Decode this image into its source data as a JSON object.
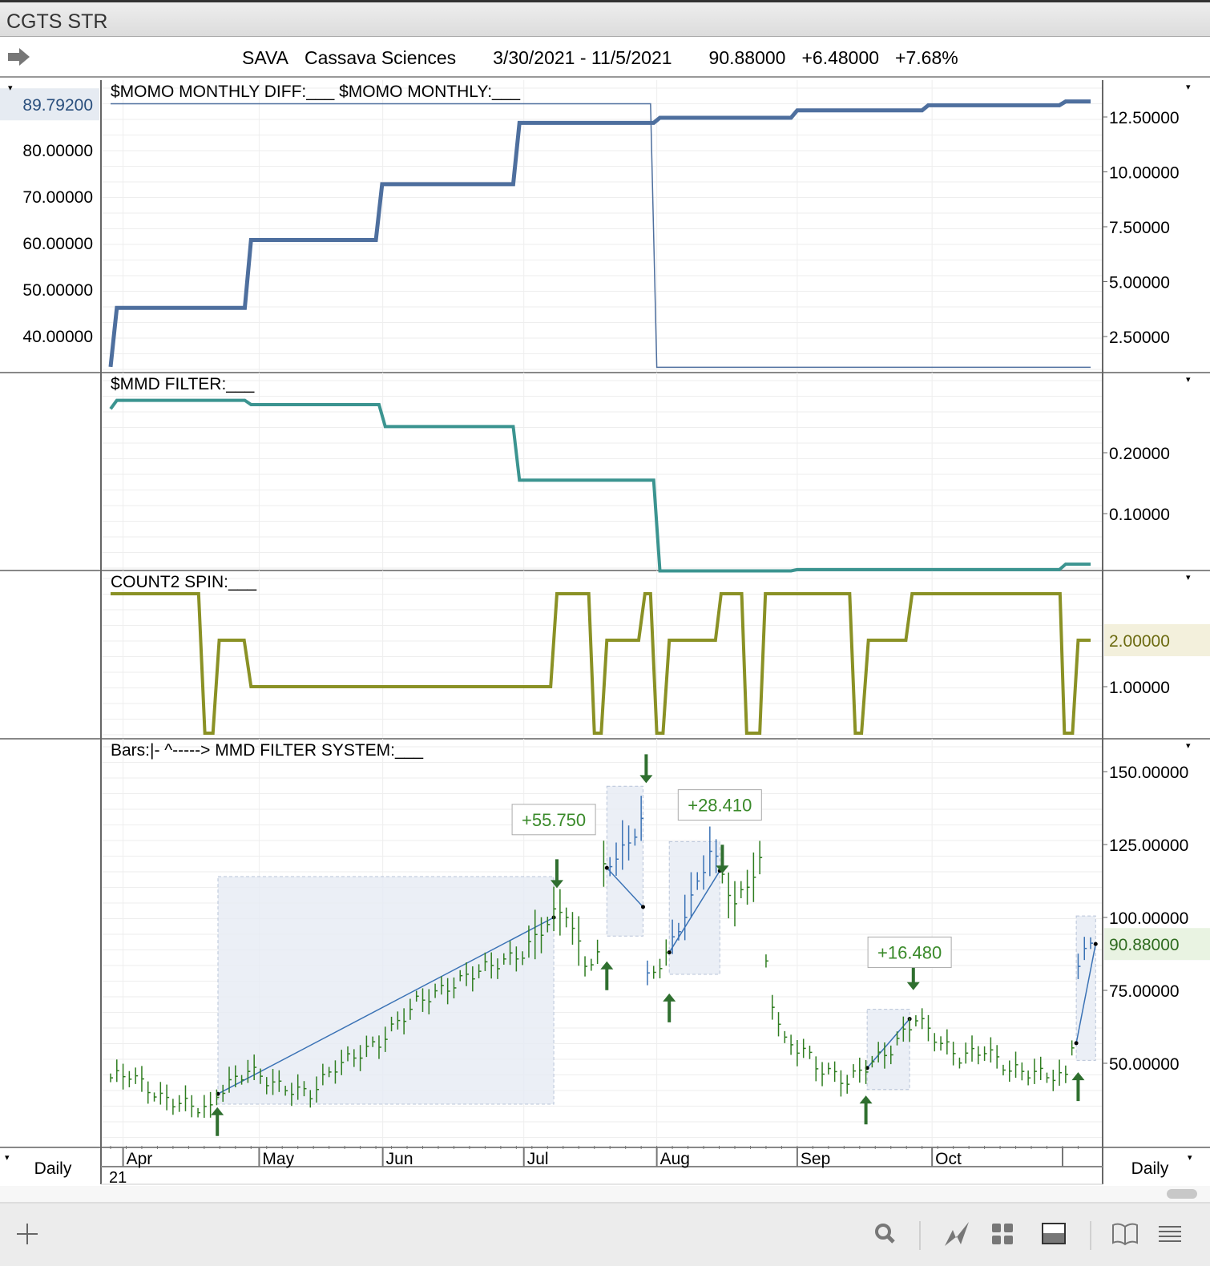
{
  "window": {
    "title": "CGTS STR"
  },
  "header": {
    "symbol": "SAVA",
    "company": "Cassava Sciences",
    "date_range": "3/30/2021 - 11/5/2021",
    "last": "90.88000",
    "change": "+6.48000",
    "change_pct": "+7.68%"
  },
  "colors": {
    "momo": "#4e6f9e",
    "diff": "#4e6f9e",
    "filter": "#3b9490",
    "spin": "#8a9125",
    "bar_up": "#2e7d1f",
    "trade_box": "#e6ebf4",
    "trade_line": "#3a72b5",
    "arrow": "#2f6f2f",
    "label": "#3a8a2a"
  },
  "chart_data": [
    {
      "type": "line",
      "title": "$MOMO MONTHLY DIFF:___    $MOMO MONTHLY:___",
      "left_ticks": [
        "80.00000",
        "70.00000",
        "60.00000",
        "50.00000",
        "40.00000"
      ],
      "left_tick_values": [
        80,
        70,
        60,
        50,
        40
      ],
      "left_current": "89.79200",
      "left_current_value": 89.792,
      "right_ticks": [
        "12.50000",
        "10.00000",
        "7.50000",
        "5.00000",
        "2.50000"
      ],
      "right_tick_values": [
        12.5,
        10,
        7.5,
        5,
        2.5
      ],
      "series": [
        {
          "name": "$MOMO MONTHLY",
          "axis": "left",
          "points": [
            [
              0,
              33.3
            ],
            [
              1,
              46
            ],
            [
              21.5,
              46
            ],
            [
              22.5,
              60.6
            ],
            [
              42.5,
              60.6
            ],
            [
              43.5,
              72.6
            ],
            [
              64.5,
              72.6
            ],
            [
              65.5,
              85.8
            ],
            [
              87,
              85.8
            ],
            [
              88,
              86.9
            ],
            [
              109,
              86.9
            ],
            [
              110,
              88.5
            ],
            [
              130,
              88.5
            ],
            [
              131,
              89.6
            ],
            [
              152,
              89.6
            ],
            [
              153,
              90.4
            ],
            [
              157,
              90.4
            ]
          ]
        },
        {
          "name": "$MOMO MONTHLY DIFF",
          "axis": "right",
          "points": [
            [
              0,
              13.1
            ],
            [
              86.5,
              13.1
            ],
            [
              87.5,
              1.1
            ],
            [
              157,
              1.1
            ]
          ]
        }
      ]
    },
    {
      "type": "line",
      "title": "$MMD FILTER:___",
      "right_ticks": [
        "0.20000",
        "0.10000"
      ],
      "right_tick_values": [
        0.2,
        0.1
      ],
      "series": [
        {
          "name": "$MMD FILTER",
          "points": [
            [
              0,
              0.272
            ],
            [
              1,
              0.286
            ],
            [
              21.5,
              0.286
            ],
            [
              22.5,
              0.279
            ],
            [
              43,
              0.279
            ],
            [
              44,
              0.243
            ],
            [
              64.5,
              0.243
            ],
            [
              65.5,
              0.155
            ],
            [
              87,
              0.155
            ],
            [
              88,
              0.006
            ],
            [
              109,
              0.006
            ],
            [
              110,
              0.008
            ],
            [
              152,
              0.008
            ],
            [
              153,
              0.017
            ],
            [
              157,
              0.017
            ]
          ]
        }
      ]
    },
    {
      "type": "line",
      "title": "COUNT2 SPIN:___",
      "right_ticks": [
        "1.00000"
      ],
      "right_tick_values": [
        1
      ],
      "right_current": "2.00000",
      "right_current_value": 2,
      "series": [
        {
          "name": "COUNT2 SPIN",
          "points": [
            [
              0,
              3
            ],
            [
              14.1,
              3
            ],
            [
              15.1,
              0
            ],
            [
              16.4,
              0
            ],
            [
              17.4,
              2
            ],
            [
              21.4,
              2
            ],
            [
              22.5,
              1
            ],
            [
              70.5,
              1
            ],
            [
              71.5,
              3
            ],
            [
              76.6,
              3
            ],
            [
              77.5,
              0
            ],
            [
              78.6,
              0
            ],
            [
              79.5,
              2
            ],
            [
              84.6,
              2
            ],
            [
              85.6,
              3
            ],
            [
              86.5,
              3
            ],
            [
              87.5,
              0
            ],
            [
              88.5,
              0
            ],
            [
              89.5,
              2
            ],
            [
              96.9,
              2
            ],
            [
              97.8,
              3
            ],
            [
              101.1,
              3
            ],
            [
              101.9,
              0
            ],
            [
              104,
              0
            ],
            [
              104.9,
              3
            ],
            [
              118.4,
              3
            ],
            [
              119.3,
              0
            ],
            [
              120.3,
              0
            ],
            [
              121.4,
              2
            ],
            [
              127.4,
              2
            ],
            [
              128.4,
              3
            ],
            [
              152.1,
              3
            ],
            [
              152.8,
              0
            ],
            [
              154.1,
              0
            ],
            [
              155,
              2
            ],
            [
              157,
              2
            ]
          ]
        }
      ]
    },
    {
      "type": "bar-ohlc",
      "title": "Bars:|-    ^-----> MMD FILTER SYSTEM:___",
      "right_ticks": [
        "150.00000",
        "125.00000",
        "100.00000",
        "75.00000",
        "50.00000"
      ],
      "right_tick_values": [
        150,
        125,
        100,
        75,
        50
      ],
      "right_current": "90.88000",
      "right_current_value": 90.88,
      "price_path": [
        [
          0,
          45
        ],
        [
          3,
          46.4
        ],
        [
          8,
          38
        ],
        [
          16,
          34
        ],
        [
          17,
          39.5
        ],
        [
          22,
          47.8
        ],
        [
          27,
          42
        ],
        [
          32,
          39.5
        ],
        [
          36,
          49
        ],
        [
          43,
          57
        ],
        [
          49,
          71
        ],
        [
          54,
          76
        ],
        [
          59,
          82
        ],
        [
          66,
          87.6
        ],
        [
          71,
          101
        ],
        [
          73,
          102
        ],
        [
          76,
          84
        ],
        [
          78,
          87
        ],
        [
          79,
          117
        ],
        [
          83,
          125
        ],
        [
          85,
          134
        ],
        [
          86,
          79
        ],
        [
          89,
          87
        ],
        [
          93,
          106
        ],
        [
          96,
          123
        ],
        [
          98,
          115
        ],
        [
          100,
          104
        ],
        [
          104,
          119
        ],
        [
          105,
          84
        ],
        [
          106,
          71
        ],
        [
          108,
          57
        ],
        [
          111,
          54.7
        ],
        [
          113,
          49
        ],
        [
          118,
          43.7
        ],
        [
          121,
          49
        ],
        [
          125,
          54.7
        ],
        [
          129,
          65.7
        ],
        [
          133,
          57
        ],
        [
          136,
          52
        ],
        [
          140,
          54.7
        ],
        [
          144,
          47.8
        ],
        [
          149,
          46.4
        ],
        [
          153,
          45
        ],
        [
          154,
          57
        ],
        [
          155,
          84
        ],
        [
          157,
          90.9
        ]
      ],
      "trades": [
        {
          "start": 17.2,
          "end": 71,
          "low": 36,
          "high": 114,
          "entry": 39.5,
          "exit": 100,
          "label": "+55.750"
        },
        {
          "start": 79.5,
          "end": 85.3,
          "low": 93.6,
          "high": 145,
          "entry": 117,
          "exit": 103.6,
          "label": ""
        },
        {
          "start": 89.5,
          "end": 97.6,
          "low": 80.5,
          "high": 126,
          "entry": 88,
          "exit": 116,
          "label": "+28.410"
        },
        {
          "start": 121.2,
          "end": 128,
          "low": 41,
          "high": 68.5,
          "entry": 48.4,
          "exit": 65.2,
          "label": "+16.480"
        },
        {
          "start": 154.7,
          "end": 157.8,
          "low": 51,
          "high": 100.5,
          "entry": 56.9,
          "exit": 90.9,
          "label": ""
        }
      ],
      "up_arrows": [
        [
          17.1,
          30
        ],
        [
          79.5,
          80
        ],
        [
          89.5,
          69
        ],
        [
          121,
          34
        ],
        [
          155,
          42
        ]
      ],
      "down_arrows": [
        [
          71.5,
          115
        ],
        [
          85.8,
          151
        ],
        [
          98,
          120
        ],
        [
          128.6,
          80
        ]
      ]
    }
  ],
  "x_axis": {
    "months": [
      "Apr",
      "May",
      "Jun",
      "Jul",
      "Aug",
      "Sep",
      "Oct"
    ],
    "month_index": [
      2,
      23.8,
      43.6,
      66.2,
      87.5,
      110,
      131.6
    ],
    "year": "21"
  },
  "periodicity": {
    "left": "Daily",
    "right": "Daily"
  },
  "toolbar": {
    "icons": [
      "plus-icon",
      "search-icon",
      "draw-icon",
      "grid-icon",
      "panel-icon",
      "book-icon",
      "menu-icon"
    ]
  }
}
